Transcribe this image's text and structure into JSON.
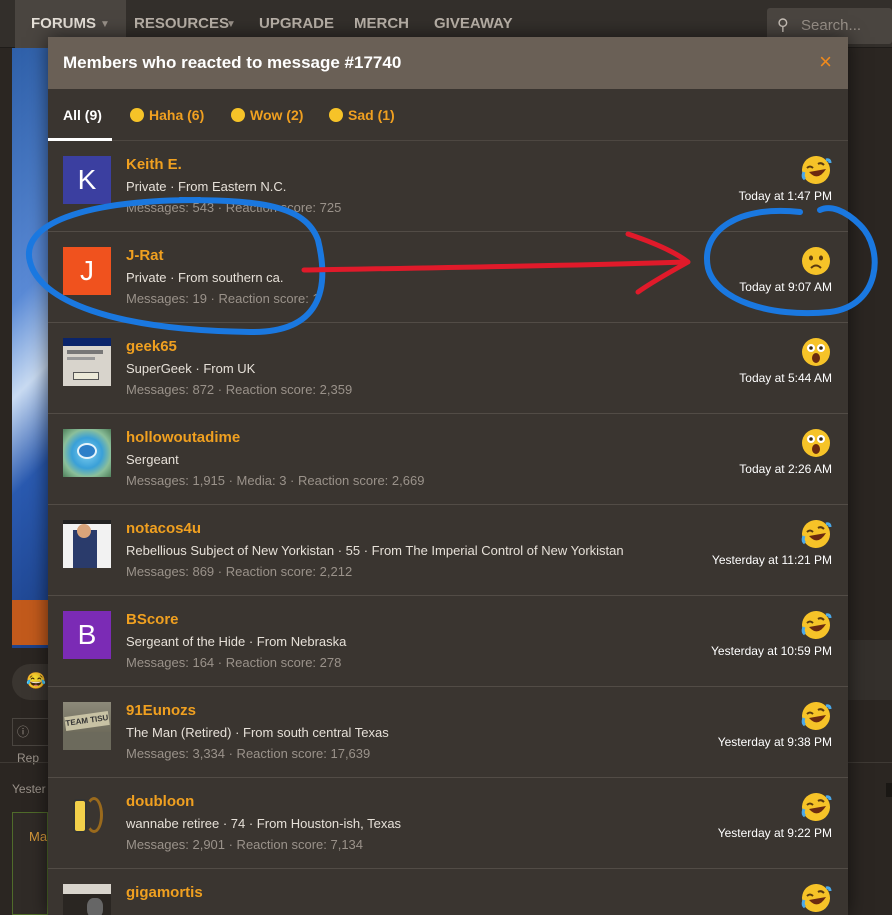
{
  "nav": {
    "tabs": [
      {
        "label": "FORUMS"
      },
      {
        "label": "RESOURCES"
      },
      {
        "label": "UPGRADE"
      },
      {
        "label": "MERCH"
      },
      {
        "label": "GIVEAWAY"
      }
    ],
    "search_placeholder": "Search..."
  },
  "background": {
    "report_label": "Rep",
    "yesterday_label": "Yester",
    "box_label": "Ma"
  },
  "modal": {
    "title": "Members who reacted to message #17740",
    "close_icon": "×",
    "tabs": [
      {
        "label": "All (9)",
        "emoji": null
      },
      {
        "label": "Haha (6)",
        "emoji": "haha"
      },
      {
        "label": "Wow (2)",
        "emoji": "wow"
      },
      {
        "label": "Sad (1)",
        "emoji": "sad"
      }
    ]
  },
  "members": [
    {
      "name": "Keith E.",
      "avatar_letter": "K",
      "avatar_color": "#3b3fa0",
      "title": "Private · From Eastern N.C.",
      "stats": "Messages: 543 · Reaction score: 725",
      "reaction": "haha",
      "time": "Today at 1:47 PM"
    },
    {
      "name": "J-Rat",
      "avatar_letter": "J",
      "avatar_color": "#f0521e",
      "title": "Private · From southern ca.",
      "stats": "Messages: 19 · Reaction score: 1",
      "reaction": "sad",
      "time": "Today at 9:07 AM"
    },
    {
      "name": "geek65",
      "avatar_letter": "",
      "avatar_image": "dialog-box",
      "title": "SuperGeek · From UK",
      "stats": "Messages: 872 · Reaction score: 2,359",
      "reaction": "wow",
      "time": "Today at 5:44 AM"
    },
    {
      "name": "hollowoutadime",
      "avatar_letter": "",
      "avatar_image": "pool",
      "title": "Sergeant",
      "stats": "Messages: 1,915 · Media: 3 · Reaction score: 2,669",
      "reaction": "wow",
      "time": "Today at 2:26 AM"
    },
    {
      "name": "notacos4u",
      "avatar_letter": "",
      "avatar_image": "book-cover",
      "title": "Rebellious Subject of New Yorkistan · 55 · From The Imperial Control of New Yorkistan",
      "stats": "Messages: 869 · Reaction score: 2,212",
      "reaction": "haha",
      "time": "Yesterday at 11:21 PM"
    },
    {
      "name": "BScore",
      "avatar_letter": "B",
      "avatar_color": "#7b2bb5",
      "title": "Sergeant of the Hide · From Nebraska",
      "stats": "Messages: 164 · Reaction score: 278",
      "reaction": "haha",
      "time": "Yesterday at 10:59 PM"
    },
    {
      "name": "91Eunozs",
      "avatar_letter": "",
      "avatar_image": "team-sign",
      "avatar_text": "TEAM TISU",
      "title": "The Man (Retired) · From south central Texas",
      "stats": "Messages: 3,334 · Reaction score: 17,639",
      "reaction": "haha",
      "time": "Yesterday at 9:38 PM"
    },
    {
      "name": "doubloon",
      "avatar_letter": "",
      "avatar_image": "cartoon",
      "title": "wannabe retiree · 74 · From Houston-ish, Texas",
      "stats": "Messages: 2,901 · Reaction score: 7,134",
      "reaction": "haha",
      "time": "Yesterday at 9:22 PM"
    },
    {
      "name": "gigamortis",
      "avatar_letter": "",
      "avatar_image": "dark-photo",
      "title": "",
      "stats": "",
      "reaction": "haha",
      "time": ""
    }
  ],
  "colors": {
    "accent": "#f0a020",
    "emoji_yellow": "#f6c328",
    "annotation_blue": "#1a78e0",
    "annotation_red": "#e01a2a"
  }
}
